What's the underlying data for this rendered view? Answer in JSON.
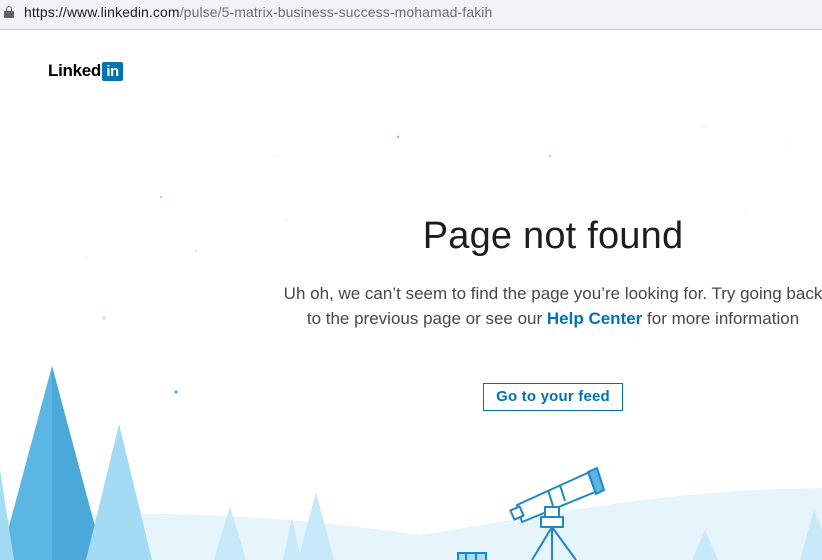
{
  "browser": {
    "url_host": "https://www.linkedin.com",
    "url_path": "/pulse/5-matrix-business-success-mohamad-fakih"
  },
  "logo": {
    "word": "Linked",
    "box": "in"
  },
  "main": {
    "title": "Page not found",
    "description_part1": "Uh oh, we can’t seem to find the page you’re looking for. Try going back to the previous page or see our ",
    "help_link": "Help Center",
    "description_part2": " for more information",
    "feed_button": "Go to your feed"
  },
  "colors": {
    "brand_blue": "#0073b1",
    "tree_dark": "#5bb6e3",
    "tree_light": "#a3dbf5",
    "ground": "#e6f4fc",
    "telescope_stroke": "#1c87c9"
  },
  "icons": {
    "lock": "lock-icon",
    "telescope": "telescope-icon"
  }
}
